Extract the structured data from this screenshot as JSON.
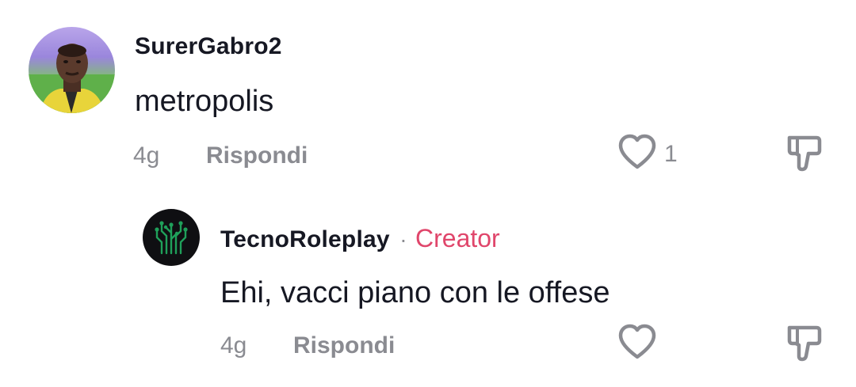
{
  "comments": [
    {
      "username": "SurerGabro2",
      "text": "metropolis",
      "time": "4g",
      "reply_label": "Rispondi",
      "like_count": "1"
    }
  ],
  "reply": {
    "username": "TecnoRoleplay",
    "separator": "·",
    "badge": "Creator",
    "text": "Ehi, vacci piano con le offese",
    "time": "4g",
    "reply_label": "Rispondi"
  },
  "icons": {
    "like": "heart-outline-icon",
    "dislike": "thumbs-down-outline-icon"
  },
  "colors": {
    "creator_accent": "#e0466b",
    "muted_text": "#8a8b91",
    "primary_text": "#161823"
  }
}
